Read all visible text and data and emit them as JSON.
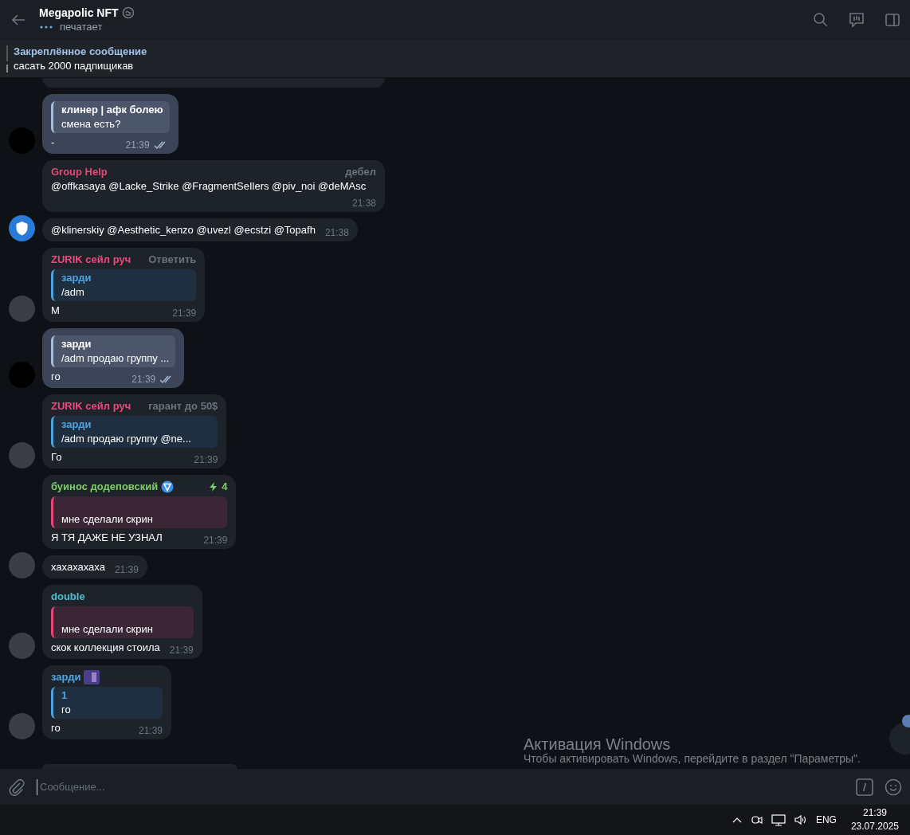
{
  "header": {
    "title": "Megapolic NFT",
    "status": "печатает"
  },
  "pinned": {
    "label": "Закреплённое сообщение",
    "text": "сасать 2000 падпищикав"
  },
  "messages": [
    {
      "kind": "own",
      "avatar": {
        "kind": "dark"
      },
      "reply": {
        "name": "клинер | афк болею",
        "text": "смена есть?"
      },
      "text": "-",
      "time": "21:39",
      "read": true
    },
    {
      "kind": "in",
      "sender": "Group Help",
      "color": "#e8477a",
      "tag": "дебел",
      "text": "@offkasaya @Lacke_Strike @FragmentSeIlers @piv_noi @deMAsc",
      "time": "21:38"
    },
    {
      "kind": "in",
      "avatar": {
        "kind": "shield"
      },
      "text": "@klinerskiy @Aesthetic_kenzo @uvezl @ecstzi @Topafh",
      "time": "21:38"
    },
    {
      "kind": "in",
      "avatar": {
        "kind": "photo"
      },
      "sender": "ZURIK сейл руч",
      "color": "#ea4a7c",
      "tag": "Ответить",
      "reply": {
        "name": "зарди",
        "text": "/adm"
      },
      "text": "М",
      "time": "21:39"
    },
    {
      "kind": "own",
      "avatar": {
        "kind": "dark"
      },
      "reply": {
        "name": "зарди",
        "text": "/adm продаю группу ..."
      },
      "text": "го",
      "time": "21:39",
      "read": true
    },
    {
      "kind": "in",
      "avatar": {
        "kind": "photo"
      },
      "sender": "ZURIK сейл руч",
      "color": "#ea4a7c",
      "tag": "гарант до 50$",
      "reply": {
        "name": "зарди",
        "text": "/adm продаю группу @ne..."
      },
      "text": "Го",
      "time": "21:39"
    },
    {
      "kind": "in",
      "sender": "буинос додеповский",
      "color": "#7ccf6a",
      "badge": true,
      "boosts": "4",
      "reply": {
        "text": "мне сделали скрин"
      },
      "text": "Я ТЯ ДАЖЕ НЕ УЗНАЛ",
      "time": "21:39"
    },
    {
      "kind": "in",
      "avatar": {
        "kind": "photo"
      },
      "text": "хахахахаха",
      "time": "21:39"
    },
    {
      "kind": "in",
      "avatar": {
        "kind": "photo"
      },
      "sender": "double",
      "color": "#4cc0d0",
      "reply": {
        "text": "мне сделали скрин"
      },
      "text": "скок коллекция стоила",
      "time": "21:39"
    },
    {
      "kind": "in",
      "avatar": {
        "kind": "photo"
      },
      "sender": "зарди",
      "color": "#4aa7e8",
      "emoji": true,
      "reply": {
        "name": "1",
        "text": "го"
      },
      "text": "го",
      "time": "21:39"
    }
  ],
  "composer": {
    "placeholder": "Сообщение..."
  },
  "watermark": {
    "title": "Активация Windows",
    "text": "Чтобы активировать Windows, перейдите в раздел \"Параметры\"."
  },
  "taskbar": {
    "language": "ENG",
    "time": "21:39",
    "date": "23.07.2025"
  }
}
